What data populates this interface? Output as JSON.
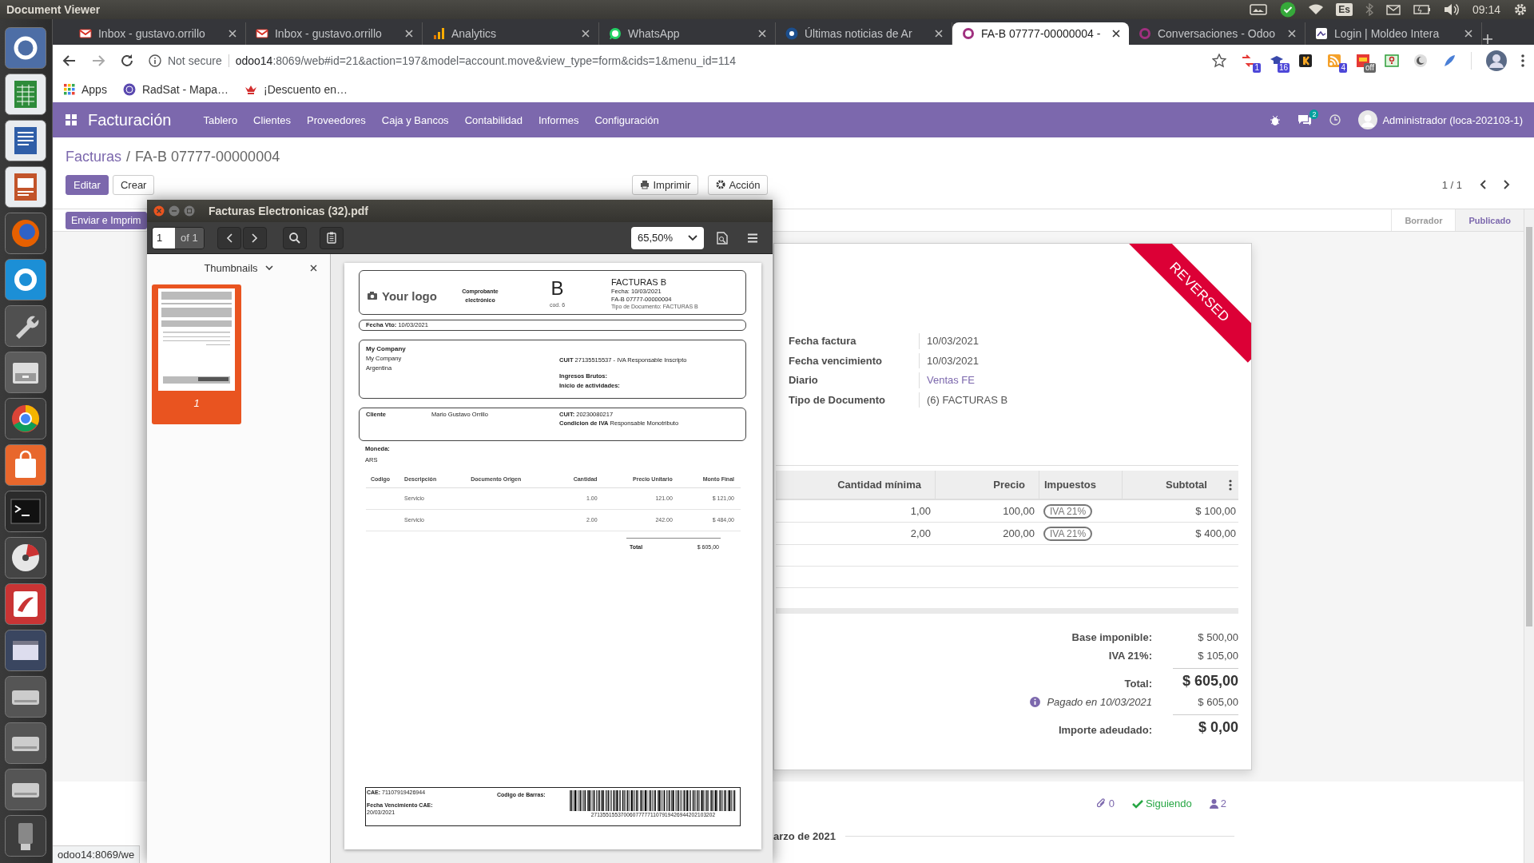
{
  "top_panel": {
    "title": "Document Viewer",
    "keyboard": "Es",
    "time": "09:14"
  },
  "browser": {
    "tabs": [
      {
        "label": "Inbox - gustavo.orrillo",
        "selected": false
      },
      {
        "label": "Inbox - gustavo.orrillo",
        "selected": false
      },
      {
        "label": "Analytics",
        "selected": false
      },
      {
        "label": "WhatsApp",
        "selected": false
      },
      {
        "label": "Últimas noticias de Ar",
        "selected": false
      },
      {
        "label": "FA-B 07777-00000004 -",
        "selected": true
      },
      {
        "label": "Conversaciones - Odoo",
        "selected": false
      },
      {
        "label": "Login | Moldeo Intera",
        "selected": false
      }
    ],
    "security": "Not secure",
    "url_host": "odoo14",
    "url_path": ":8069/web#id=21&action=197&model=account.move&view_type=form&cids=1&menu_id=114",
    "extension_badges": [
      "1",
      "16",
      "4",
      "off"
    ],
    "bookmarks": [
      "Apps",
      "RadSat - Mapa…",
      "¡Descuento en…"
    ],
    "status_url": "odoo14:8069/we"
  },
  "odoo": {
    "app": "Facturación",
    "menu": [
      "Tablero",
      "Clientes",
      "Proveedores",
      "Caja y Bancos",
      "Contabilidad",
      "Informes",
      "Configuración"
    ],
    "chat_count": "2",
    "user": "Administrador (loca-202103-1)",
    "breadcrumb": {
      "parent": "Facturas",
      "separator": "/",
      "current": "FA-B 07777-00000004"
    },
    "buttons": [
      {
        "label": "Editar",
        "kind": "primary"
      },
      {
        "label": "Crear",
        "kind": "secondary"
      }
    ],
    "actions": [
      "Imprimir",
      "Acción"
    ],
    "pager": "1 / 1",
    "send_button": "Enviar e Imprim",
    "stages": [
      {
        "label": "Borrador",
        "selected": false
      },
      {
        "label": "Publicado",
        "selected": true
      }
    ],
    "ribbon": "REVERSED",
    "fields": [
      {
        "label": "Fecha factura",
        "value": "10/03/2021",
        "kind": "text"
      },
      {
        "label": "Fecha vencimiento",
        "value": "10/03/2021",
        "kind": "text"
      },
      {
        "label": "Diario",
        "value": "Ventas FE",
        "kind": "link"
      },
      {
        "label": "Tipo de Documento",
        "value": "(6) FACTURAS B",
        "kind": "text"
      }
    ],
    "lines": {
      "columns": [
        "Cantidad mínima",
        "Precio",
        "Impuestos",
        "Subtotal"
      ],
      "rows": [
        {
          "quantity": "1,00",
          "price": "100,00",
          "tax": "IVA 21%",
          "subtotal": "$ 100,00"
        },
        {
          "quantity": "2,00",
          "price": "200,00",
          "tax": "IVA 21%",
          "subtotal": "$ 400,00"
        }
      ]
    },
    "totals": [
      {
        "label": "Base imponible:",
        "value": "$ 500,00",
        "kind": "line"
      },
      {
        "label": "IVA 21%:",
        "value": "$ 105,00",
        "kind": "line"
      },
      {
        "label": "Total:",
        "value": "$ 605,00",
        "kind": "total"
      },
      {
        "label": "Pagado en 10/03/2021",
        "value": "$ 605,00",
        "kind": "payment"
      },
      {
        "label": "Importe adeudado:",
        "value": "$ 0,00",
        "kind": "total"
      }
    ],
    "chatter": {
      "attachments": "0",
      "follow": "Siguiendo",
      "followers": "2",
      "date": "arzo de 2021"
    }
  },
  "pdf": {
    "title": "Facturas Electronicas (32).pdf",
    "page": "1",
    "page_count": "of 1",
    "zoom": "65,50%",
    "sidebar_title": "Thumbnails",
    "thumbnails": [
      {
        "label": "1",
        "selected": true
      }
    ],
    "document": {
      "logo": "Your logo",
      "doc_kind": "Comprobante electrónico",
      "letter": "B",
      "code": "cod. 6",
      "title": "FACTURAS B",
      "date": "Fecha: 10/03/2021",
      "number": "FA-B 07777-00000004",
      "doc_type": "Tipo de Documento: FACTURAS B",
      "due": "**Fecha Vto:** 10/03/2021",
      "company": {
        "name": "My Company",
        "lines": [
          "My Company",
          "Argentina"
        ],
        "tax_id": "**CUIT** 27135515537 - IVA Responsable Inscripto",
        "gross_income": "Ingresos Brutos:",
        "start": "Inicio de actividades:"
      },
      "client": {
        "label": "Cliente",
        "name": "Mario Gustavo Orrillo",
        "tax_id": "**CUIT:** 20230080217",
        "vat": "**Condicion de IVA** Responsable Monotributo"
      },
      "currency_label": "Moneda:",
      "currency": "ARS",
      "columns": [
        "Codigo",
        "Descripción",
        "Documento Origen",
        "Cantidad",
        "Precio Unitario",
        "Monto Final"
      ],
      "rows": [
        {
          "description": "Servicio",
          "quantity": "1.00",
          "unit_price": "121.00",
          "amount": "$ 121,00"
        },
        {
          "description": "Servicio",
          "quantity": "2.00",
          "unit_price": "242.00",
          "amount": "$ 484,00"
        }
      ],
      "total_label": "Total",
      "total": "$ 605,00",
      "cae": "**CAE:** 71107919426944",
      "cae_due_label": "Fecha Vencimiento CAE:",
      "cae_due": "20/03/2021",
      "barcode_label": "Codigo de Barras:",
      "barcode": "271355155370060777771107919426944202103202"
    }
  }
}
